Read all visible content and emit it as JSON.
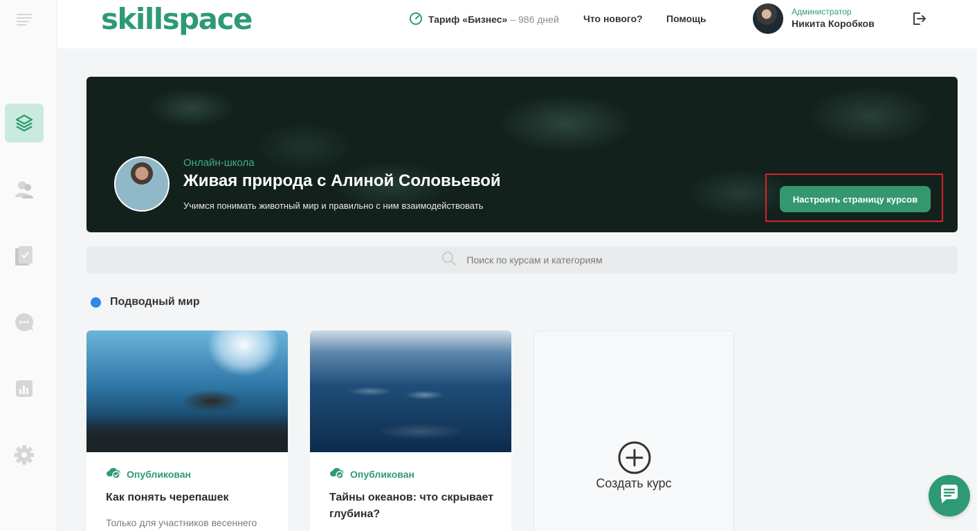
{
  "sidebar": {
    "items": [
      {
        "icon": "menu-icon"
      },
      {
        "icon": "courses-icon",
        "active": true
      },
      {
        "icon": "users-icon"
      },
      {
        "icon": "tasks-icon"
      },
      {
        "icon": "chat-icon"
      },
      {
        "icon": "analytics-icon"
      },
      {
        "icon": "settings-icon"
      }
    ]
  },
  "header": {
    "logo": "skillspace",
    "tariff_name": "Тариф «Бизнес»",
    "tariff_days": "– 986 дней",
    "whats_new": "Что нового?",
    "help": "Помощь",
    "user_role": "Администратор",
    "user_name": "Никита Коробков"
  },
  "banner": {
    "subtitle": "Онлайн-школа",
    "title": "Живая природа с Алиной Соловьевой",
    "description": "Учимся понимать животный мир и правильно с ним взаимодействовать",
    "configure_button": "Настроить страницу курсов"
  },
  "search": {
    "placeholder": "Поиск по курсам и категориям"
  },
  "category": {
    "name": "Подводный мир",
    "color": "#2f86ef"
  },
  "courses": [
    {
      "status": "Опубликован",
      "title": "Как понять черепашек",
      "description": "Только для участников весеннего"
    },
    {
      "status": "Опубликован",
      "title": "Тайны океанов: что скрывает глубина?",
      "description": ""
    }
  ],
  "create_course": {
    "label": "Создать курс"
  },
  "colors": {
    "brand": "#2e9a73",
    "highlight": "#e01f26"
  }
}
